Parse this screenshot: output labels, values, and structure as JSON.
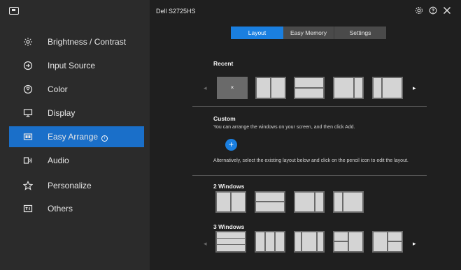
{
  "sidebar": {
    "items": [
      {
        "label": "Brightness / Contrast",
        "icon": "brightness-icon"
      },
      {
        "label": "Input Source",
        "icon": "input-source-icon"
      },
      {
        "label": "Color",
        "icon": "color-icon"
      },
      {
        "label": "Display",
        "icon": "display-icon"
      },
      {
        "label": "Easy Arrange",
        "icon": "easy-arrange-icon",
        "active": true
      },
      {
        "label": "Audio",
        "icon": "audio-icon"
      },
      {
        "label": "Personalize",
        "icon": "star-icon"
      },
      {
        "label": "Others",
        "icon": "others-icon"
      }
    ],
    "info_glyph": "i"
  },
  "header": {
    "model": "Dell S2725HS"
  },
  "tabs": [
    {
      "label": "Layout",
      "active": true
    },
    {
      "label": "Easy Memory"
    },
    {
      "label": "Settings"
    }
  ],
  "recent": {
    "title": "Recent",
    "remove_glyph": "×",
    "prev_glyph": "◂",
    "next_glyph": "▸"
  },
  "custom": {
    "title": "Custom",
    "instruction": "You can arrange the windows on your screen, and then click Add.",
    "add_glyph": "+",
    "alternative": "Alternatively, select the existing layout below and click on the pencil icon to edit the layout."
  },
  "two_windows": {
    "title": "2 Windows"
  },
  "three_windows": {
    "title": "3 Windows",
    "prev_glyph": "◂",
    "next_glyph": "▸"
  },
  "colors": {
    "accent": "#1a7fe0",
    "active_nav": "#1a6fc9",
    "sidebar_bg": "#2b2b2b",
    "main_bg": "#1f1f1f"
  }
}
